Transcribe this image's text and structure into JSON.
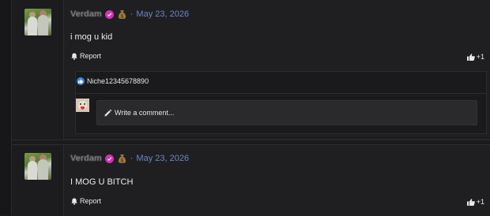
{
  "posts": [
    {
      "username": "Verdam",
      "separator": "·",
      "date": "May 23, 2026",
      "body": "i mog u kid",
      "report_label": "Report",
      "reaction_count": "+1",
      "reactors": [
        "Niche12345678890"
      ],
      "comment_placeholder": "Write a comment..."
    },
    {
      "username": "Verdam",
      "separator": "·",
      "date": "May 23, 2026",
      "body": "I MOG U BITCH",
      "report_label": "Report",
      "reaction_count": "+1"
    }
  ],
  "colors": {
    "background": "#1b1b1d",
    "date": "#6e85c0",
    "verified_badge": "#d62fb9",
    "like_badge": "#3b82d8"
  },
  "icons": [
    "verified-icon",
    "money-bag-icon",
    "bell-icon",
    "thumbs-up-icon",
    "pencil-icon"
  ]
}
